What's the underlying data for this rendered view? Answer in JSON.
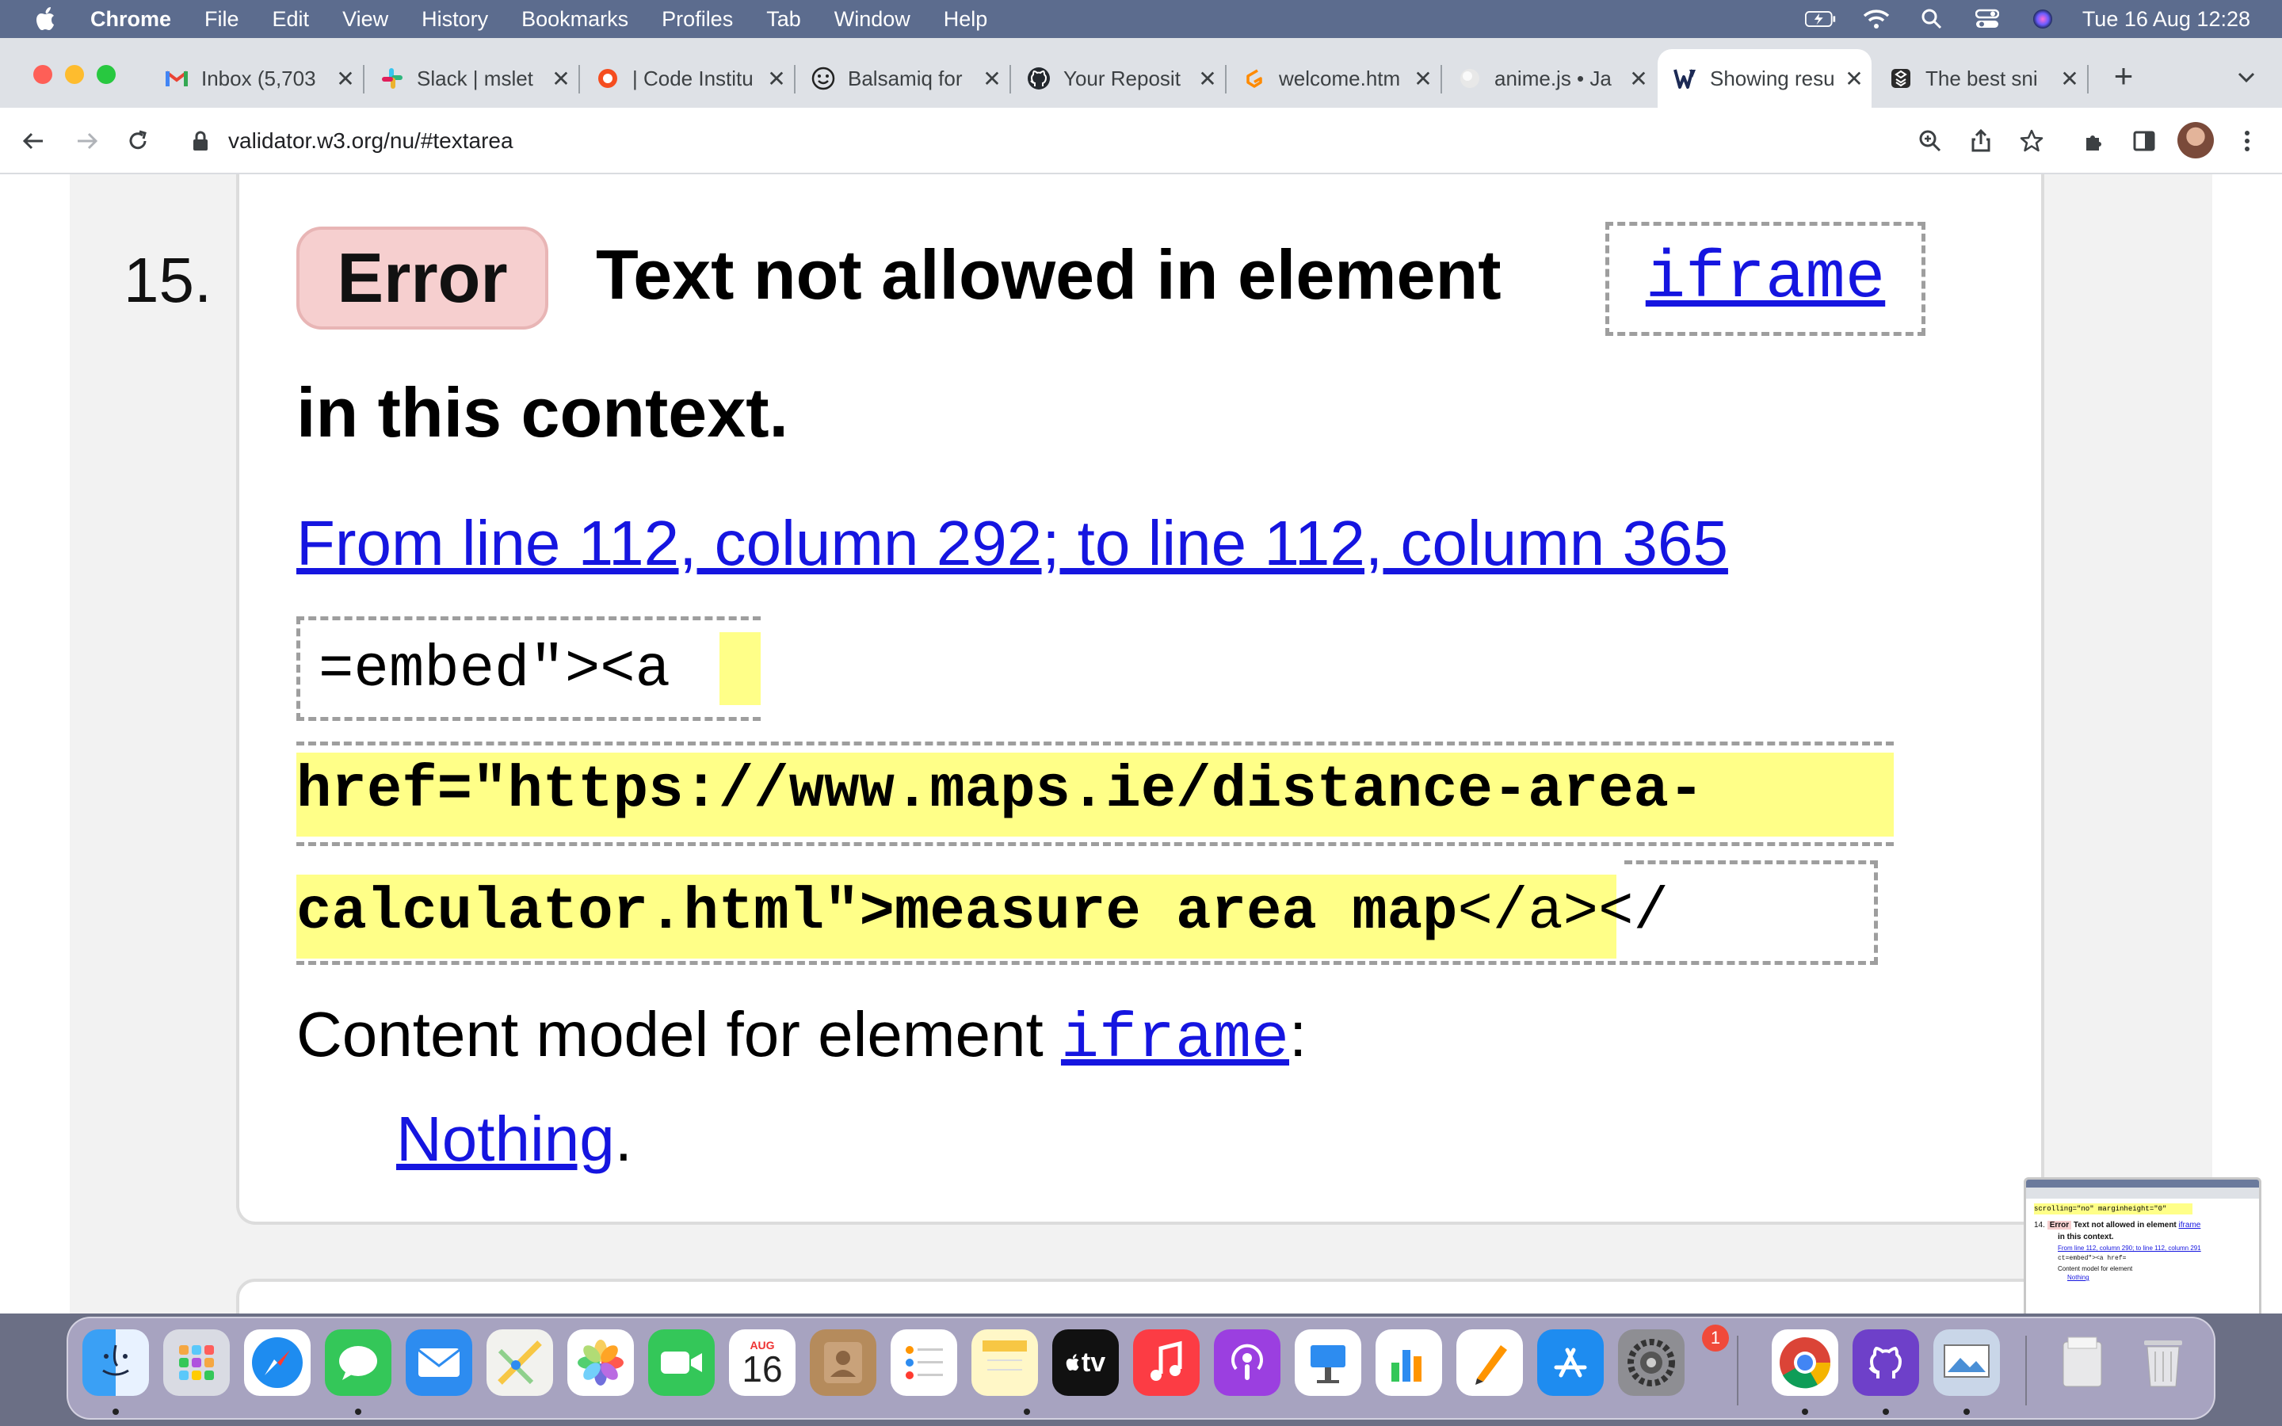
{
  "menubar": {
    "app_name": "Chrome",
    "items": [
      "File",
      "Edit",
      "View",
      "History",
      "Bookmarks",
      "Profiles",
      "Tab",
      "Window",
      "Help"
    ],
    "clock": "Tue 16 Aug  12:28"
  },
  "tabs": [
    {
      "title": "Inbox (5,703",
      "icon": "gmail-icon"
    },
    {
      "title": "Slack | mslet",
      "icon": "slack-icon"
    },
    {
      "title": "| Code Institu",
      "icon": "code-institute-icon"
    },
    {
      "title": "Balsamiq for",
      "icon": "balsamiq-icon"
    },
    {
      "title": "Your Reposit",
      "icon": "github-icon"
    },
    {
      "title": "welcome.htm",
      "icon": "gitpod-icon"
    },
    {
      "title": "anime.js • Ja",
      "icon": "anime-js-icon"
    },
    {
      "title": "Showing resu",
      "icon": "w3c-validator-icon",
      "active": true
    },
    {
      "title": "The best sni",
      "icon": "snippet-icon"
    }
  ],
  "address_bar": {
    "url": "validator.w3.org/nu/#textarea"
  },
  "message": {
    "number": "15.",
    "type_label": "Error",
    "title_prefix": "Text not allowed in element",
    "title_element": "iframe",
    "title_suffix": "in this context.",
    "location": "From line 112, column 292; to line 112, column 365",
    "extract_line1": "=embed\"><a",
    "extract_line2": "href=\"https://www.maps.ie/distance-area-",
    "extract_line3_highlighted": "calculator.html\">measure area map",
    "extract_line3_tail": "</a></",
    "content_model_prefix": "Content model for element",
    "content_model_element": "iframe",
    "content_model_colon": ":",
    "content_model_value": "Nothing",
    "content_model_period": "."
  },
  "thumbnail": {
    "code_line": "scrolling=\"no\" marginheight=\"0\"",
    "number": "14.",
    "type_label": "Error",
    "title": "Text not allowed in element",
    "element": "iframe",
    "title_suffix": "in this context.",
    "location": "From line 112, column 290; to line 112, column 291",
    "extract": "ct=embed\"><a href=",
    "content_model": "Content model for element",
    "value": "Nothing"
  },
  "dock": {
    "calendar_month": "AUG",
    "calendar_day": "16",
    "settings_badge": "1",
    "tv_label": "tv"
  },
  "colors": {
    "error_pill": "#f6cfcf",
    "highlight": "#ffff88",
    "link": "#1515e0",
    "menubar": "#5c6c8e"
  }
}
